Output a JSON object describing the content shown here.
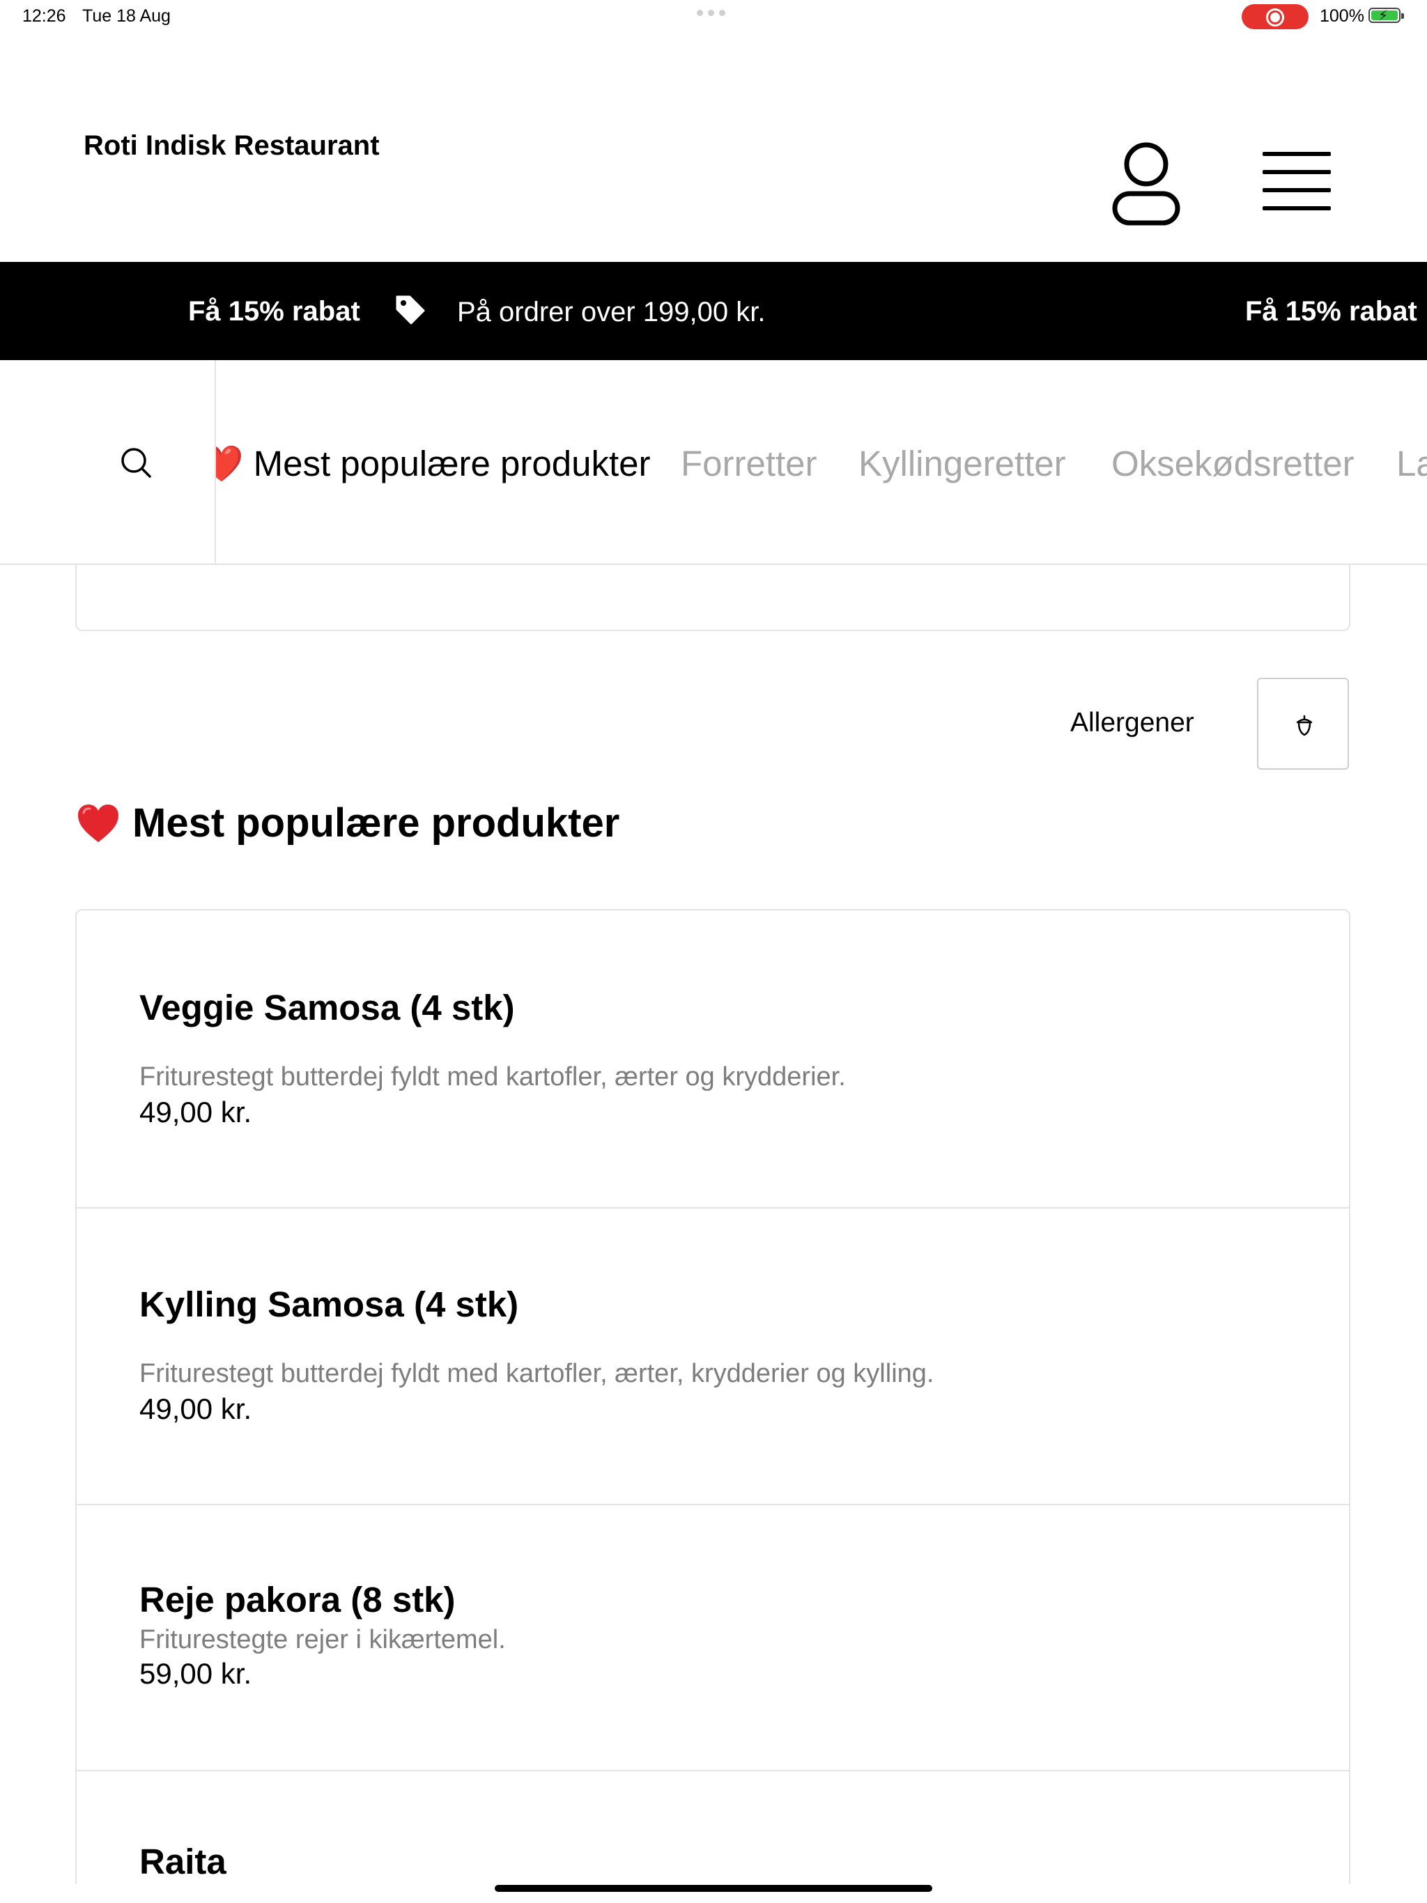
{
  "status_bar": {
    "time": "12:26",
    "date": "Tue 18 Aug",
    "battery": "100%",
    "recording_color": "#e5322d",
    "battery_color": "#39c445"
  },
  "header": {
    "title": "Roti Indisk Restaurant",
    "user_icon": "user-icon",
    "menu_icon": "hamburger-menu-icon"
  },
  "promo": {
    "title": "Få 15% rabat",
    "text": "På ordrer over 199,00 kr.",
    "icon": "tag-icon",
    "background": "#000000"
  },
  "category_nav": {
    "search_icon": "search-icon",
    "items": [
      {
        "label": "❤️ Mest populære produkter",
        "active": true
      },
      {
        "label": "Forretter",
        "active": false
      },
      {
        "label": "Kyllingeretter",
        "active": false
      },
      {
        "label": "Oksekødsretter",
        "active": false
      },
      {
        "label": "Lammeretter",
        "active": false
      }
    ]
  },
  "filters": {
    "allergen_label": "Allergener",
    "allergen_icon": "acorn-icon"
  },
  "section": {
    "title": "Mest populære produkter",
    "icon": "heart-icon"
  },
  "products": [
    {
      "name": "Veggie Samosa (4 stk)",
      "description": "Friturestegt butterdej fyldt med kartofler, ærter og krydderier.",
      "price": "49,00 kr."
    },
    {
      "name": "Kylling Samosa (4 stk)",
      "description": "Friturestegt butterdej fyldt med kartofler, ærter, krydderier og kylling.",
      "price": "49,00 kr."
    },
    {
      "name": "Reje pakora (8 stk)",
      "description": "Friturestegte rejer i kikærtemel.",
      "price": "59,00 kr."
    },
    {
      "name": "Raita",
      "description": "",
      "price": ""
    }
  ]
}
